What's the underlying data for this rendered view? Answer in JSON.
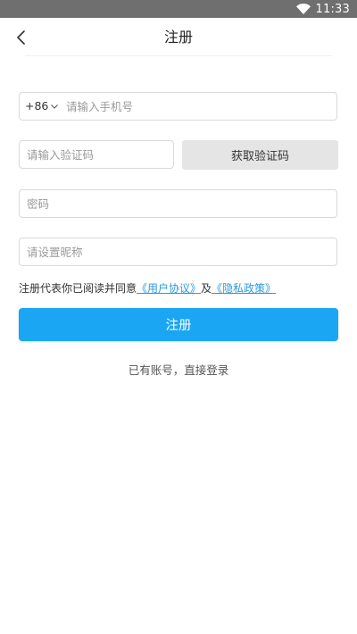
{
  "status_bar": {
    "time": "11:33"
  },
  "nav": {
    "title": "注册"
  },
  "form": {
    "country_code": "+86",
    "phone_placeholder": "请输入手机号",
    "code_placeholder": "请输入验证码",
    "get_code_label": "获取验证码",
    "password_placeholder": "密码",
    "nickname_placeholder": "请设置昵称",
    "agreement_prefix": "注册代表你已阅读并同意",
    "user_agreement_link": "《用户协议》",
    "agreement_and": "及",
    "privacy_policy_link": "《隐私政策》",
    "submit_label": "注册",
    "login_link": "已有账号，直接登录"
  },
  "colors": {
    "status_bar": "#6f6f6f",
    "primary": "#1aa6f2",
    "link": "#2a9ae0",
    "code_button_bg": "#e5e5e5"
  },
  "icons": {
    "back": "chevron-left-icon",
    "country_code_dropdown": "chevron-down-icon",
    "wifi": "wifi-icon"
  }
}
